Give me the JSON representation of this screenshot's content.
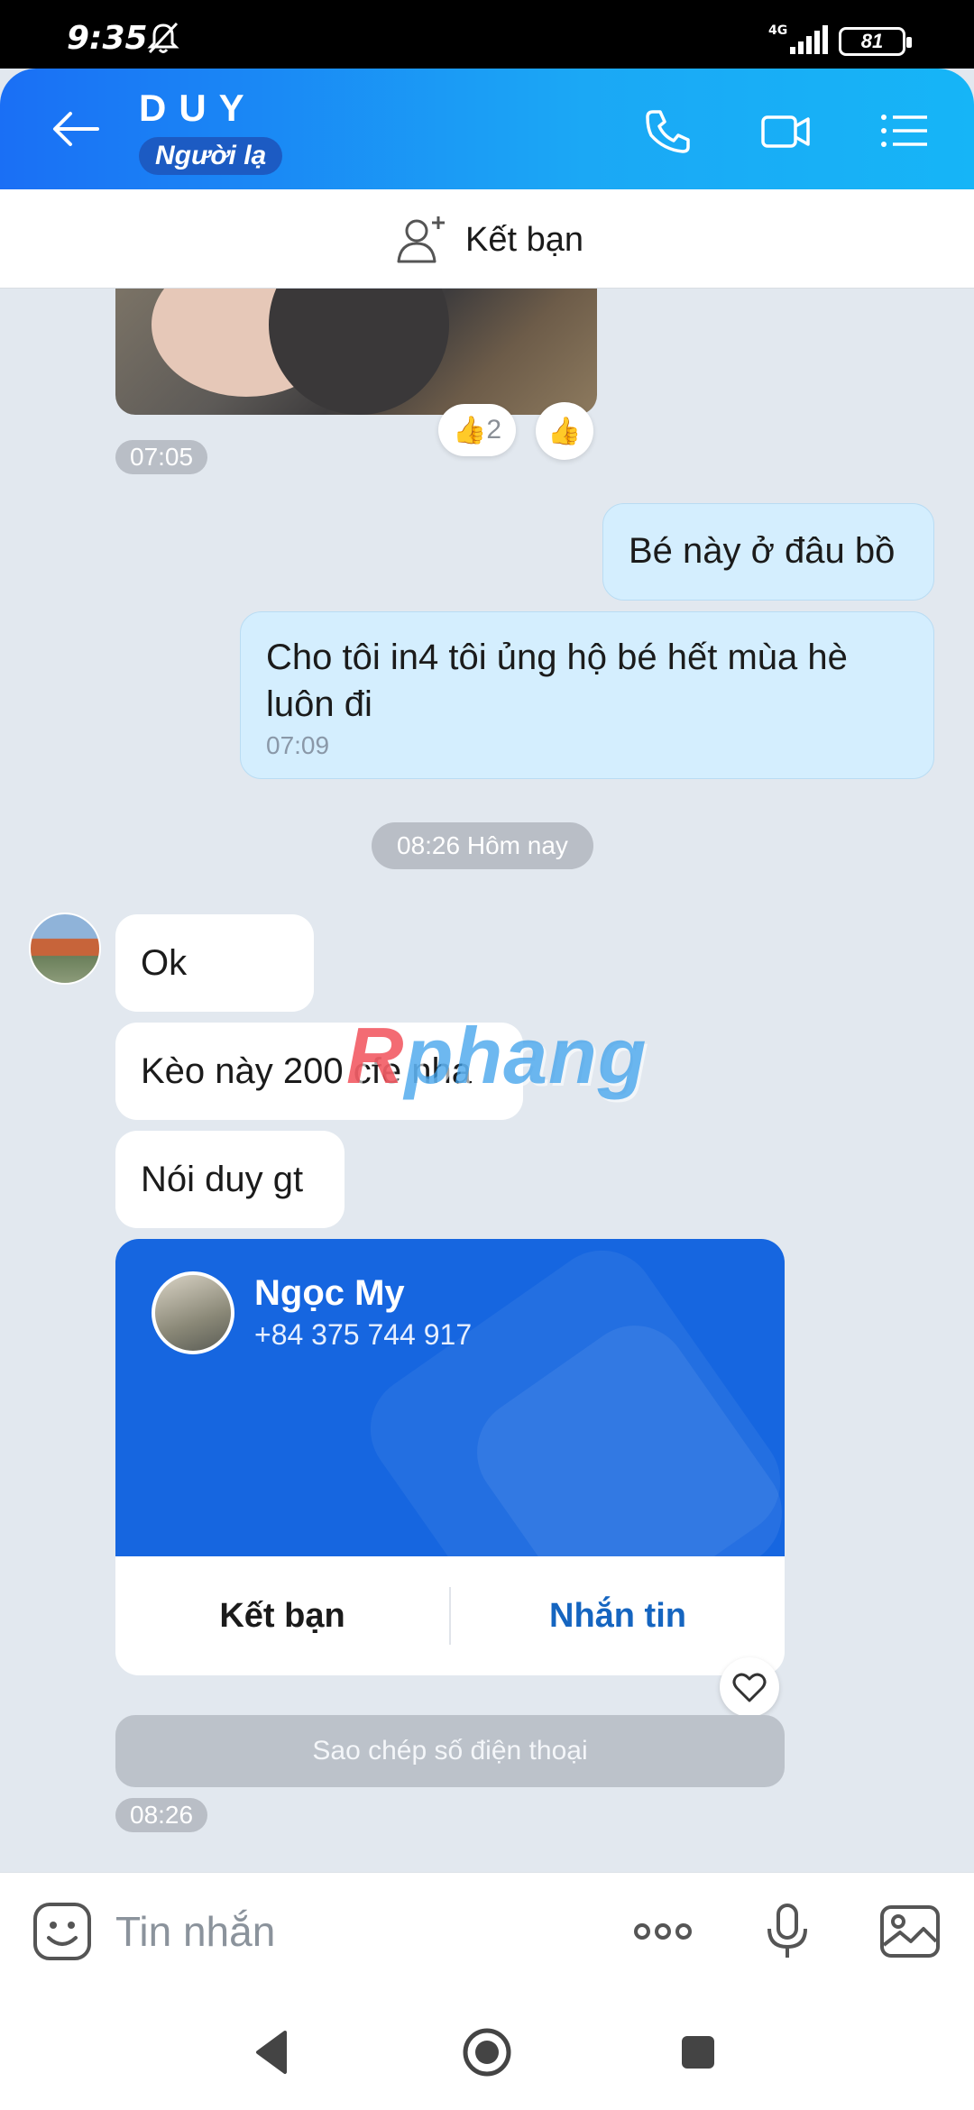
{
  "status_bar": {
    "time": "9:35",
    "network": "4G",
    "battery": "81"
  },
  "header": {
    "contact_name": "DUY",
    "badge": "Người lạ"
  },
  "add_friend_bar": {
    "label": "Kết bạn"
  },
  "messages": {
    "reaction_count": "2",
    "photo_time": "07:05",
    "me_1": "Bé này ở đâu bồ",
    "me_2": "Cho tôi in4 tôi ủng hộ bé hết mùa hè luôn đi",
    "me_2_time": "07:09",
    "day_divider": "08:26 Hôm nay",
    "them_1": "Ok",
    "them_2": "Kèo này 200 cfe nha",
    "them_3": "Nói duy gt",
    "last_time": "08:26"
  },
  "contact_card": {
    "name": "Ngọc My",
    "phone": "+84 375 744 917",
    "add_friend_label": "Kết bạn",
    "message_label": "Nhắn tin",
    "copy_phone_label": "Sao chép số điện thoại"
  },
  "watermark": {
    "part1": "R",
    "part2": "phang"
  },
  "input": {
    "placeholder": "Tin nhắn"
  },
  "colors": {
    "header_start": "#1a6ff5",
    "header_end": "#16b5f7",
    "card_blue": "#1666e0",
    "link_blue": "#1565c0",
    "sent_bubble": "#d4eefe"
  }
}
